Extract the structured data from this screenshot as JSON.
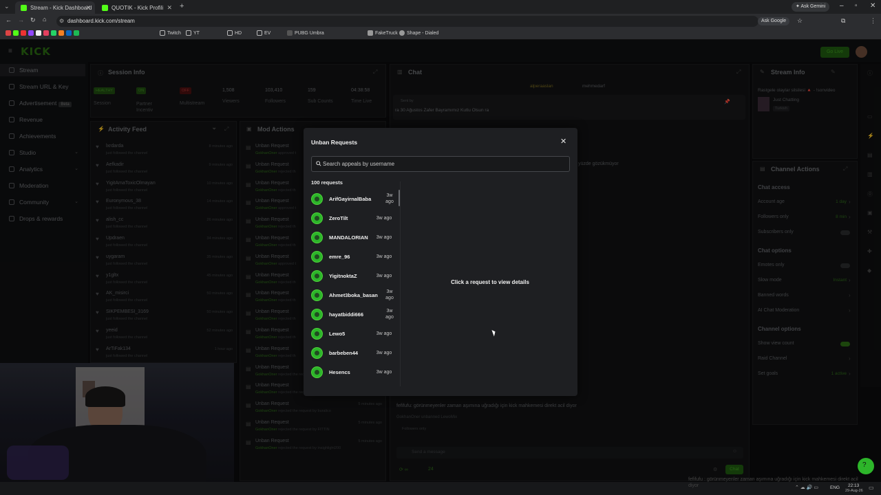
{
  "browser": {
    "tabs": [
      {
        "title": "Stream - Kick Dashboard",
        "active": true
      },
      {
        "title": "QUOTIK - Kick Profili",
        "active": false
      }
    ],
    "ask_gemini": "Ask Gemini",
    "url": "dashboard.kick.com/stream",
    "ask_google": "Ask Google",
    "bookmarks": [
      "Twitch",
      "YT",
      "HD",
      "EV",
      "PUBG Umbra",
      "FakeTruck",
      "Shape - Dialed"
    ]
  },
  "app": {
    "logo": "KICK",
    "go_live": "Go Live"
  },
  "sidebar": {
    "items": [
      {
        "label": "Stream",
        "active": true
      },
      {
        "label": "Stream URL & Key"
      },
      {
        "label": "Advertisement",
        "badge": "Beta"
      },
      {
        "label": "Revenue"
      },
      {
        "label": "Achievements"
      },
      {
        "label": "Studio",
        "chevron": true
      },
      {
        "label": "Analytics",
        "chevron": true
      },
      {
        "label": "Moderation"
      },
      {
        "label": "Community",
        "chevron": true
      },
      {
        "label": "Drops & rewards"
      }
    ]
  },
  "session": {
    "title": "Session Info",
    "stats": [
      {
        "badge": "HEALTHY",
        "label": "Session",
        "color": "#2a6b12"
      },
      {
        "badge": "ON",
        "label": "Partner Incentiv",
        "color": "#2a6b12"
      },
      {
        "badge": "OFF",
        "label": "Multistream",
        "color": "#7a1a1a"
      },
      {
        "value": "1,508",
        "label": "Viewers"
      },
      {
        "value": "103,410",
        "label": "Followers"
      },
      {
        "value": "159",
        "label": "Sub Counts"
      },
      {
        "value": "04:38:58",
        "label": "Time Live"
      }
    ]
  },
  "activity": {
    "title": "Activity Feed",
    "items": [
      {
        "name": "lxrdarda",
        "sub": "just followed the channel",
        "time": "8 minutes ago"
      },
      {
        "name": "Aefkadir",
        "sub": "just followed the channel",
        "time": "9 minutes ago"
      },
      {
        "name": "YigitAmaToxicOlmayan",
        "sub": "just followed the channel",
        "time": "10 minutes ago"
      },
      {
        "name": "Euronymous_38",
        "sub": "just followed the channel",
        "time": "14 minutes ago"
      },
      {
        "name": "alish_cc",
        "sub": "just followed the channel",
        "time": "26 minutes ago"
      },
      {
        "name": "Updraen",
        "sub": "just followed the channel",
        "time": "34 minutes ago"
      },
      {
        "name": "uygaram",
        "sub": "just followed the channel",
        "time": "35 minutes ago"
      },
      {
        "name": "y1gltx",
        "sub": "just followed the channel",
        "time": "45 minutes ago"
      },
      {
        "name": "AK_misirci",
        "sub": "just followed the channel",
        "time": "50 minutes ago"
      },
      {
        "name": "SIKPEMBESI_3169",
        "sub": "just followed the channel",
        "time": "50 minutes ago"
      },
      {
        "name": "yeeid",
        "sub": "just followed the channel",
        "time": "52 minutes ago"
      },
      {
        "name": "ArTiFak134",
        "sub": "just followed the channel",
        "time": "1 hour ago"
      }
    ]
  },
  "mod": {
    "title": "Mod Actions",
    "items": [
      {
        "title": "Unban Request",
        "by": "GokhanOner",
        "rest": " approved t"
      },
      {
        "title": "Unban Request",
        "by": "GokhanOner",
        "rest": " rejected th"
      },
      {
        "title": "Unban Request",
        "by": "GokhanOner",
        "rest": " rejected th"
      },
      {
        "title": "Unban Request",
        "by": "GokhanOner",
        "rest": " approved t"
      },
      {
        "title": "Unban Request",
        "by": "GokhanOner",
        "rest": " rejected th"
      },
      {
        "title": "Unban Request",
        "by": "GokhanOner",
        "rest": " rejected th"
      },
      {
        "title": "Unban Request",
        "by": "GokhanOner",
        "rest": " approved t"
      },
      {
        "title": "Unban Request",
        "by": "GokhanOner",
        "rest": " rejected th"
      },
      {
        "title": "Unban Request",
        "by": "GokhanOner",
        "rest": " rejected th"
      },
      {
        "title": "Unban Request",
        "by": "GokhanOner",
        "rest": " rejected th"
      },
      {
        "title": "Unban Request",
        "by": "GokhanOner",
        "rest": " rejected th"
      },
      {
        "title": "Unban Request",
        "by": "GokhanOner",
        "rest": " rejected th"
      },
      {
        "title": "Unban Request",
        "by": "GokhanOner",
        "rest": " rejected the request by 3Tolpanky",
        "time": ""
      },
      {
        "title": "Unban Request",
        "by": "GokhanOner",
        "rest": " rejected the request by xxlolxdharmcat",
        "time": "5 minutes ago"
      },
      {
        "title": "Unban Request",
        "by": "GokhanOner",
        "rest": " rejected the request by buralico",
        "time": "5 minutes ago"
      },
      {
        "title": "Unban Request",
        "by": "GokhanOner",
        "rest": " rejected the request by FITTIN",
        "time": "5 minutes ago"
      },
      {
        "title": "Unban Request",
        "by": "GokhanOner",
        "rest": " rejected the request by insighlight200",
        "time": "5 minutes ago"
      }
    ]
  },
  "chat": {
    "title": "Chat",
    "pinned_users": [
      "alperaaslan",
      "mehmedarf"
    ],
    "pinned_msg": "Sent by",
    "pinned_text": "ra 30 Ağustos Zafer Bayramımız Kutlu Olsun ra",
    "line_a": "yüzde gözükmüyor",
    "line_b": "fefifufu: görünmeyenler zaman aşımına uğradığı için kick mahkemesi direkt acil diyor",
    "line_c_user": "GokhanOner",
    "line_c_rest": " unbanned LewoMix",
    "followers_only": "Followers only",
    "input_placeholder": "Send a message",
    "count": "24",
    "chat_btn": "Chat"
  },
  "stream_info": {
    "title": "Stream Info",
    "stream_title": "Rastgele olaylar silsilesi 🔺 - !sonvideo",
    "category": "Just Chatting",
    "language": "Turkish"
  },
  "channel_actions": {
    "title": "Channel Actions",
    "sections": [
      {
        "head": "Chat access",
        "rows": [
          {
            "label": "Account age",
            "value": "1 day"
          },
          {
            "label": "Followers only",
            "value": "8 min"
          },
          {
            "label": "Subscribers only",
            "toggle": false
          }
        ]
      },
      {
        "head": "Chat options",
        "rows": [
          {
            "label": "Emotes only",
            "toggle": false
          },
          {
            "label": "Slow mode",
            "value": "Instant"
          },
          {
            "label": "Banned words",
            "value": ""
          },
          {
            "label": "AI Chat Moderation",
            "value": ""
          }
        ]
      },
      {
        "head": "Channel options",
        "rows": [
          {
            "label": "Show view count",
            "toggle": true
          },
          {
            "label": "Raid Channel",
            "value": ""
          },
          {
            "label": "Set goals",
            "value": "1 active"
          }
        ]
      }
    ]
  },
  "modal": {
    "title": "Unban Requests",
    "search_placeholder": "Search appeals by username",
    "count_label": "100 requests",
    "detail_prompt": "Click a request to view details",
    "requests": [
      {
        "username": "ArifGayirnalBaba",
        "when": "3w ago"
      },
      {
        "username": "ZeroTilt",
        "when": "3w ago"
      },
      {
        "username": "MANDALORIAN",
        "when": "3w ago"
      },
      {
        "username": "emre_96",
        "when": "3w ago"
      },
      {
        "username": "YigitnoktaZ",
        "when": "3w ago"
      },
      {
        "username": "Ahmet3boka_basan",
        "when": "3w ago"
      },
      {
        "username": "hayatbiddi666",
        "when": "3w ago"
      },
      {
        "username": "Lewo5",
        "when": "3w ago"
      },
      {
        "username": "barbeben44",
        "when": "3w ago"
      },
      {
        "username": "Hesencs",
        "when": "3w ago"
      }
    ]
  },
  "taskbar": {
    "lang": "ENG",
    "time": "22:13",
    "date": "29-Aug-26",
    "overlay_text": "fefifufu : görünmeyenler zaman aşımına uğradığı için kick mahkemesi direkt acil diyor"
  }
}
